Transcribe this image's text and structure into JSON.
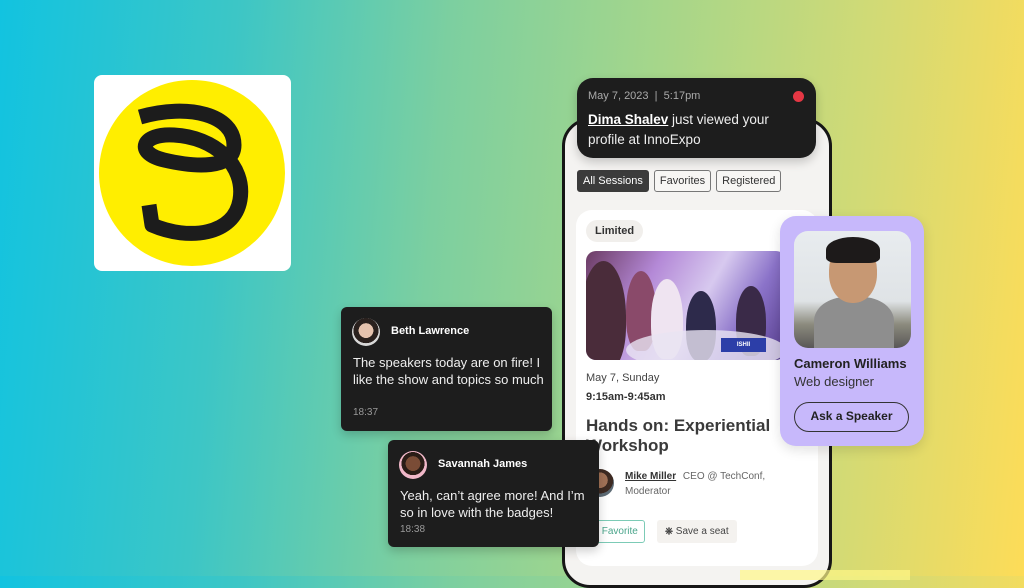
{
  "brand": {
    "logo_icon": "swirl-logo-icon",
    "logo_bg": "#ffee00",
    "logo_stroke": "#1c1c1c"
  },
  "notification": {
    "date": "May 7, 2023",
    "time": "5:17pm",
    "separator": "|",
    "name": "Dima Shalev",
    "text": " just viewed your profile at InnoExpo",
    "status_color": "#e53744"
  },
  "filters": [
    {
      "label": "All Sessions",
      "active": true
    },
    {
      "label": "Favorites",
      "active": false
    },
    {
      "label": "Registered",
      "active": false
    }
  ],
  "session": {
    "badge": "Limited",
    "photo_label": "ISHII",
    "date": "May 7, Sunday",
    "time": "9:15am-9:45am",
    "title": "Hands on: Experiential Workshop",
    "moderator": {
      "name": "Mike Miller",
      "title": "CEO @ TechConf,",
      "role": "Moderator"
    },
    "favorite_label": "Favorite",
    "seat_label": "Save a seat"
  },
  "chats": [
    {
      "name": "Beth Lawrence",
      "message": "The speakers today are on fire! I like the show and topics so much",
      "time": "18:37"
    },
    {
      "name": "Savannah James",
      "message": "Yeah, can’t agree more! And I’m so in love with the badges!",
      "time": "18:38"
    }
  ],
  "speaker": {
    "name": "Cameron Williams",
    "role": "Web designer",
    "button": "Ask a Speaker",
    "card_color": "#c7b8fb"
  }
}
